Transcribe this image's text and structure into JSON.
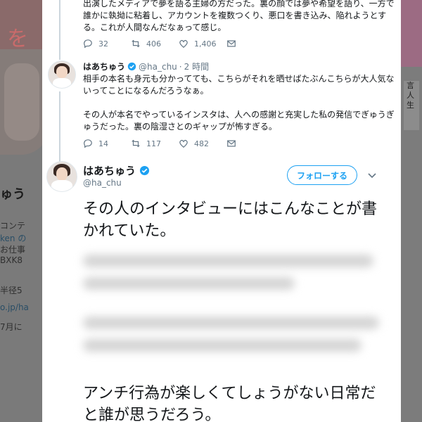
{
  "background": {
    "left_lines": [
      "ゅう",
      "コンテ",
      "ken の",
      "お仕事",
      "BXK8",
      "半径5",
      "o.jp/ha",
      "7月に"
    ],
    "banner_char": "を",
    "right_chars": [
      "言",
      "人",
      "生"
    ]
  },
  "thread_tweet": {
    "text": "出演したメディアで夢を語る主婦の方だった。裏の顔では夢や希望を語り、一方で誰かに執拗に粘着し、アカウントを複数つくり、悪口を書き込み、陥れようとする。これが人間なんだなぁって感じ。",
    "replies": "32",
    "retweets": "406",
    "likes": "1,406"
  },
  "reply_tweet": {
    "name": "はあちゅう",
    "handle": "@ha_chu",
    "separator": "·",
    "time": "2 時間",
    "text": "相手の本名も身元も分かってても、こちらがそれを晒せばたぶんこちらが大人気ないってことになるんだろうなぁ。\n\nその人が本名でやっているインスタは、人への感謝と充実した私の発信でぎゅうぎゅうだった。裏の陰湿さとのギャップが怖すぎる。",
    "replies": "14",
    "retweets": "117",
    "likes": "482"
  },
  "main_tweet": {
    "name": "はあちゅう",
    "handle": "@ha_chu",
    "follow_label": "フォローする",
    "text_top": "その人のインタビューにはこんなことが書かれていた。",
    "text_bottom": "アンチ行為が楽しくてしょうがない日常だと誰が思うだろう。"
  },
  "colors": {
    "accent": "#1da1f2",
    "muted": "#657786",
    "verified": "#1da1f2"
  }
}
